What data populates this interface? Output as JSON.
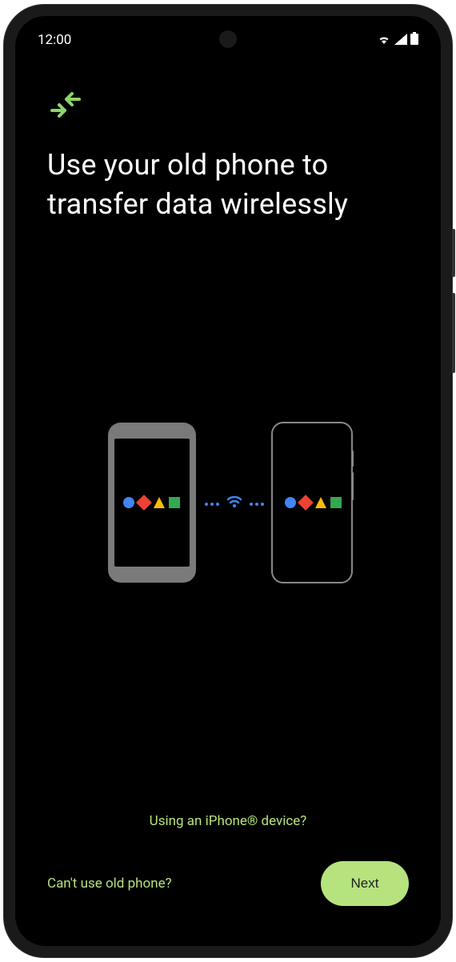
{
  "status_bar": {
    "time": "12:00"
  },
  "page": {
    "title": "Use your old phone to transfer data wirelessly",
    "iphone_link": "Using an iPhone® device?",
    "cant_use_link": "Can't use old phone?",
    "next_button": "Next"
  },
  "colors": {
    "accent": "#b6e37e",
    "background": "#000000",
    "text": "#ffffff"
  }
}
